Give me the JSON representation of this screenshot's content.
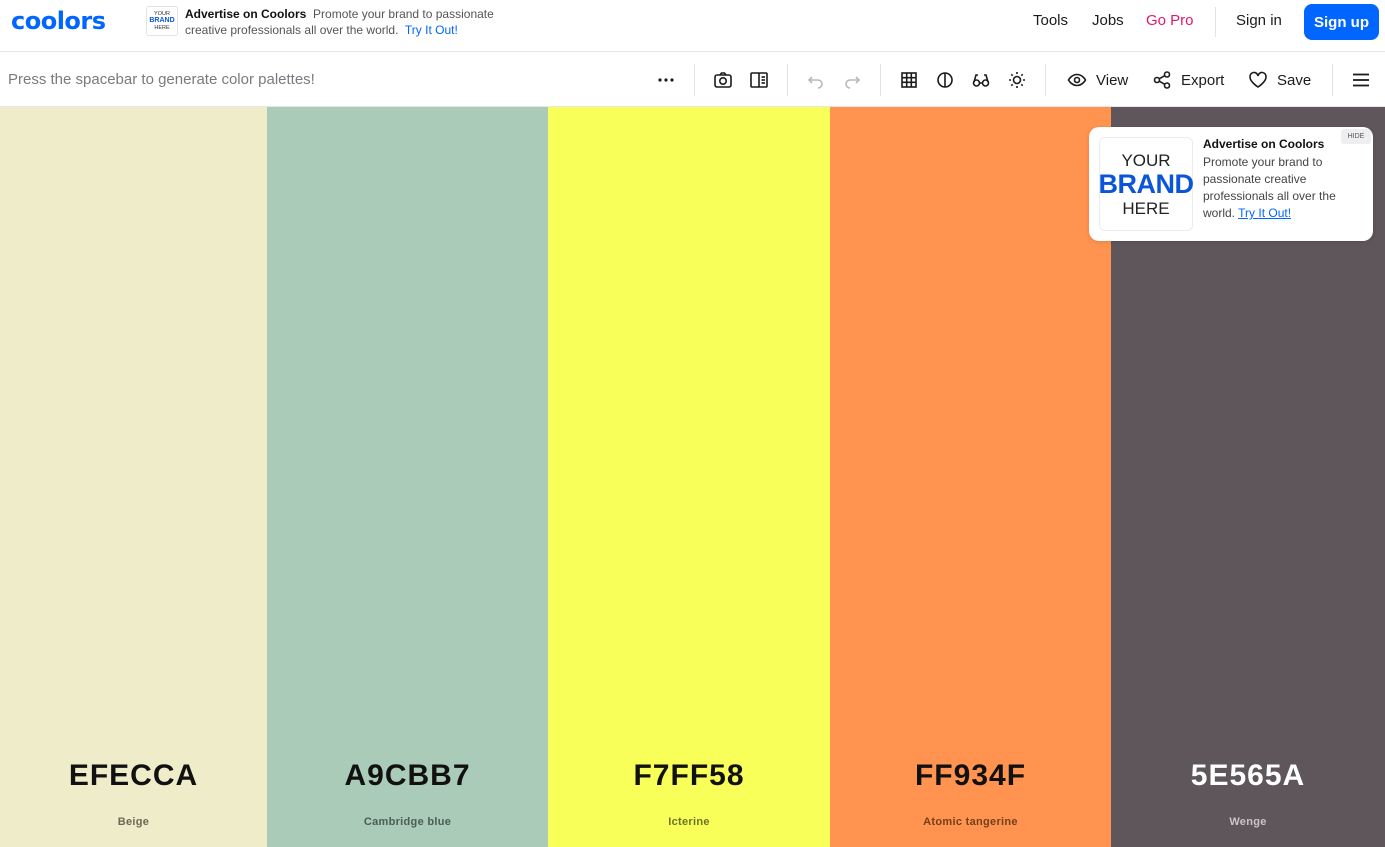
{
  "header": {
    "logo": "coolors",
    "ad_mini": {
      "line1": "YOUR",
      "line2": "BRAND",
      "line3": "HERE"
    },
    "ad_title": "Advertise on Coolors",
    "ad_text": "Promote your brand to passionate creative professionals all over the world.",
    "ad_link": "Try It Out!",
    "nav": {
      "tools": "Tools",
      "jobs": "Jobs",
      "go_pro": "Go Pro"
    },
    "sign_in": "Sign in",
    "sign_up": "Sign up"
  },
  "toolbar": {
    "hint": "Press the spacebar to generate color palettes!",
    "icons": [
      "more-icon",
      "camera-icon",
      "sidebar-icon",
      "undo-icon",
      "redo-icon",
      "grid-icon",
      "contrast-icon",
      "glasses-icon",
      "brightness-icon",
      "menu-icon"
    ],
    "view_label": "View",
    "export_label": "Export",
    "save_label": "Save"
  },
  "palette": [
    {
      "hex": "EFECCA",
      "name": "Beige",
      "color": "#EFECCA",
      "text_color": "#111111",
      "name_color": "#6b6955"
    },
    {
      "hex": "A9CBB7",
      "name": "Cambridge blue",
      "color": "#A9CBB7",
      "text_color": "#111111",
      "name_color": "#4c5d52"
    },
    {
      "hex": "F7FF58",
      "name": "Icterine",
      "color": "#F7FF58",
      "text_color": "#111111",
      "name_color": "#6e7226"
    },
    {
      "hex": "FF934F",
      "name": "Atomic tangerine",
      "color": "#FF934F",
      "text_color": "#111111",
      "name_color": "#733f1f"
    },
    {
      "hex": "5E565A",
      "name": "Wenge",
      "color": "#5E565A",
      "text_color": "#ffffff",
      "name_color": "#c9c4c6"
    }
  ],
  "ad_card": {
    "hide_label": "HIDE",
    "image": {
      "line1": "YOUR",
      "line2": "BRAND",
      "line3": "HERE"
    },
    "title": "Advertise on Coolors",
    "body": "Promote your brand to passionate creative professionals all over the world.",
    "link": "Try It Out!"
  }
}
